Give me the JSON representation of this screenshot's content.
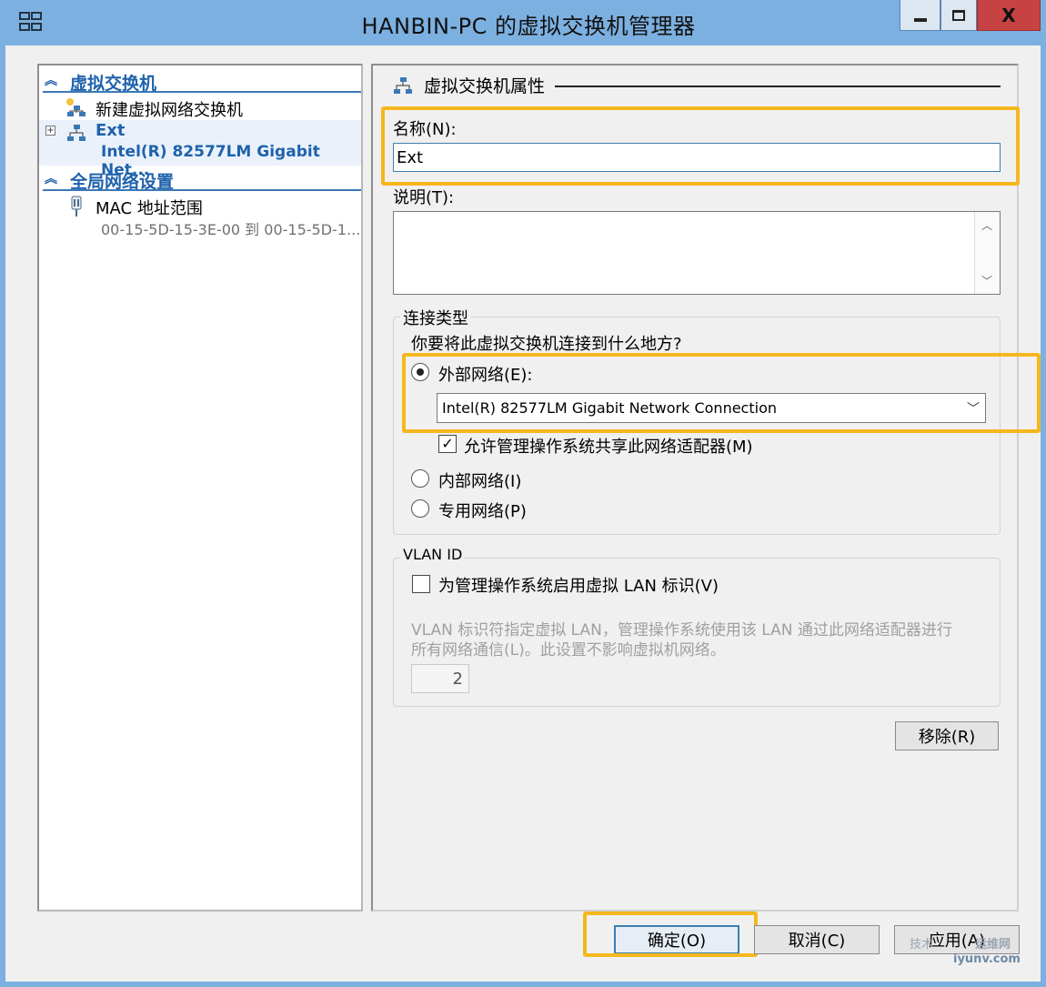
{
  "window": {
    "title": "HANBIN-PC 的虚拟交换机管理器",
    "close_glyph": "X"
  },
  "sidebar": {
    "section_virtual_switches": "虚拟交换机",
    "new_switch_label": "新建虚拟网络交换机",
    "ext_switch_name": "Ext",
    "ext_switch_adapter": "Intel(R) 82577LM Gigabit Net...",
    "section_global": "全局网络设置",
    "mac_label": "MAC 地址范围",
    "mac_range": "00-15-5D-15-3E-00 到 00-15-5D-1..."
  },
  "properties": {
    "group_title": "虚拟交换机属性",
    "name_label": "名称(N):",
    "name_value": "Ext",
    "notes_label": "说明(T):",
    "notes_value": ""
  },
  "connection": {
    "legend": "连接类型",
    "question": "你要将此虚拟交换机连接到什么地方?",
    "external_label": "外部网络(E):",
    "external_checked": true,
    "adapter_selected": "Intel(R) 82577LM Gigabit Network Connection",
    "allow_mgmt_label": "允许管理操作系统共享此网络适配器(M)",
    "allow_mgmt_checked": true,
    "internal_label": "内部网络(I)",
    "private_label": "专用网络(P)"
  },
  "vlan": {
    "legend": "VLAN ID",
    "enable_label": "为管理操作系统启用虚拟 LAN 标识(V)",
    "enable_checked": false,
    "description_line1": "VLAN 标识符指定虚拟 LAN，管理操作系统使用该 LAN 通过此网络适配器进行",
    "description_line2": "所有网络通信(L)。此设置不影响虚拟机网络。",
    "vlan_value": "2"
  },
  "buttons": {
    "remove": "移除(R)",
    "ok": "确定(O)",
    "cancel": "取消(C)",
    "apply": "应用(A)"
  },
  "watermark": {
    "line1": "技术",
    "line2": "运维网",
    "line3": "iyunv.com"
  },
  "colors": {
    "titlebar": "#7cb0e0",
    "accent_blue": "#1f62ac",
    "highlight": "#f5b71d",
    "close_button": "#c74343"
  }
}
